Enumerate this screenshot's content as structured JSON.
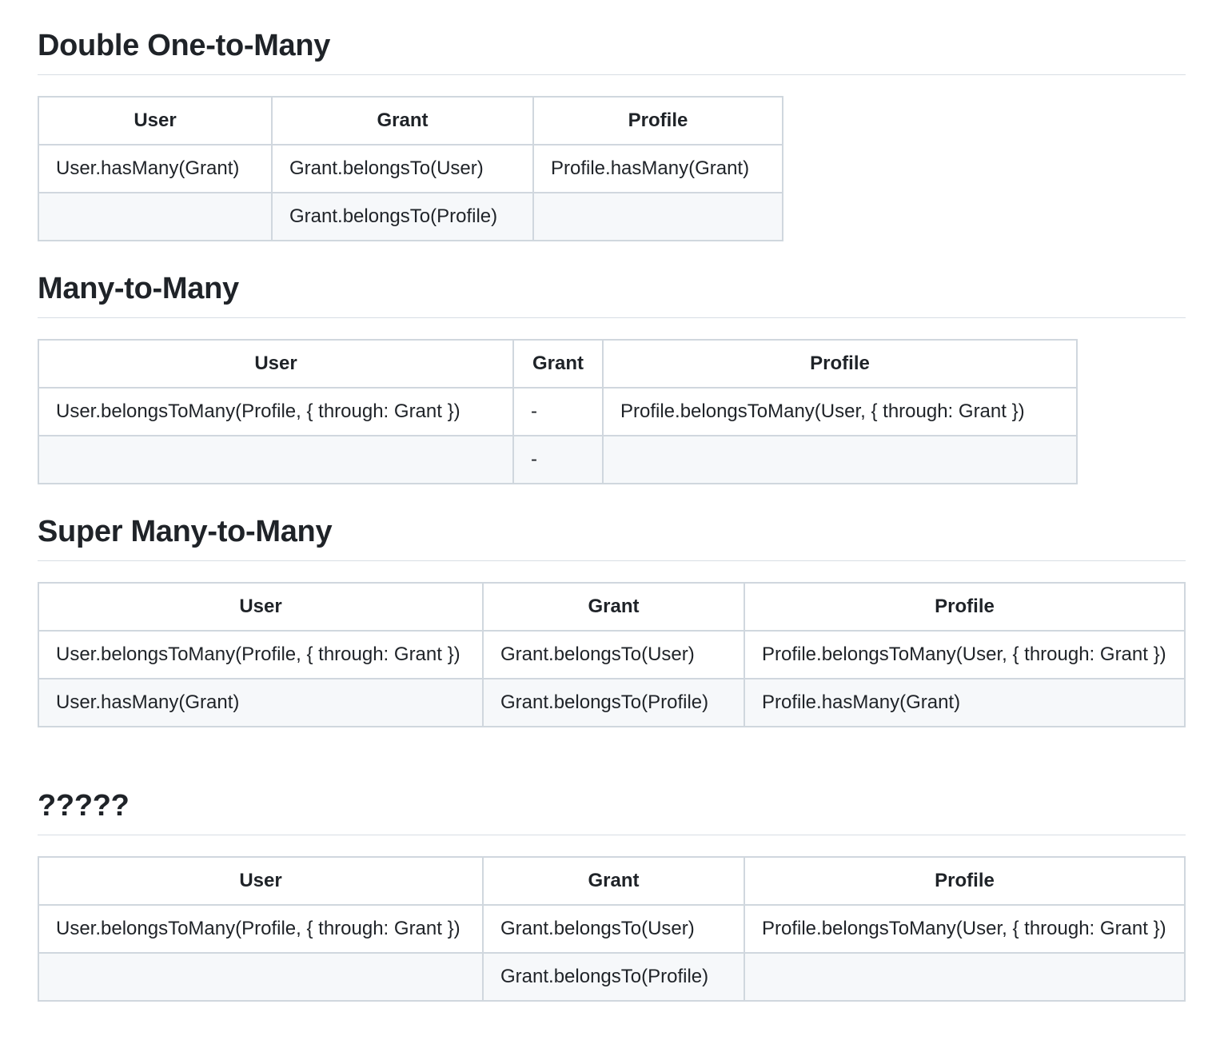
{
  "sections": [
    {
      "title": "Double One-to-Many",
      "headers": [
        "User",
        "Grant",
        "Profile"
      ],
      "rows": [
        [
          "User.hasMany(Grant)",
          "Grant.belongsTo(User)",
          "Profile.hasMany(Grant)"
        ],
        [
          "",
          "Grant.belongsTo(Profile)",
          ""
        ]
      ]
    },
    {
      "title": "Many-to-Many",
      "headers": [
        "User",
        "Grant",
        "Profile"
      ],
      "rows": [
        [
          "User.belongsToMany(Profile, { through: Grant })",
          "-",
          "Profile.belongsToMany(User, { through: Grant })"
        ],
        [
          "",
          "-",
          ""
        ]
      ]
    },
    {
      "title": "Super Many-to-Many",
      "headers": [
        "User",
        "Grant",
        "Profile"
      ],
      "rows": [
        [
          "User.belongsToMany(Profile, { through: Grant })",
          "Grant.belongsTo(User)",
          "Profile.belongsToMany(User, { through: Grant })"
        ],
        [
          "User.hasMany(Grant)",
          "Grant.belongsTo(Profile)",
          "Profile.hasMany(Grant)"
        ]
      ]
    },
    {
      "title": "?????",
      "headers": [
        "User",
        "Grant",
        "Profile"
      ],
      "rows": [
        [
          "User.belongsToMany(Profile, { through: Grant })",
          "Grant.belongsTo(User)",
          "Profile.belongsToMany(User, { through: Grant })"
        ],
        [
          "",
          "Grant.belongsTo(Profile)",
          ""
        ]
      ]
    }
  ]
}
